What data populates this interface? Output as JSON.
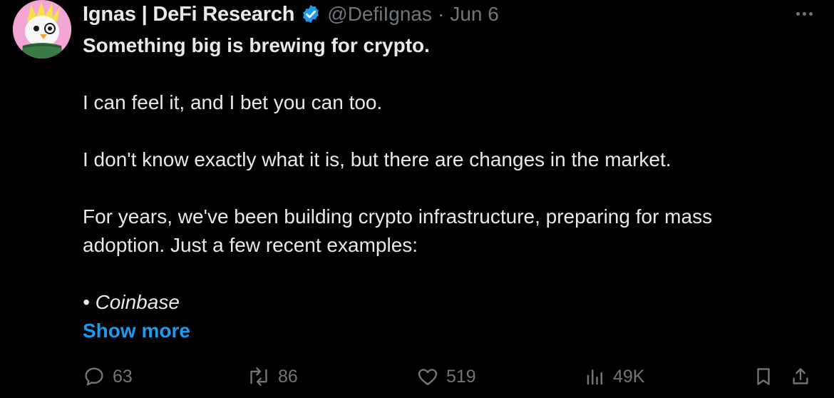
{
  "post": {
    "author_name": "Ignas | DeFi Research",
    "handle": "@DefiIgnas",
    "separator": "·",
    "date": "Jun 6",
    "body": {
      "lead": "Something big is brewing for crypto.",
      "p1": "I can feel it, and I bet you can too.",
      "p2": "I don't know exactly what it is, but there are changes in the market.",
      "p3_line1": "For years, we've been building crypto infrastructure, preparing for mass",
      "p3_line2": "adoption. Just a few recent examples:",
      "bullet": "• Coinbase"
    },
    "show_more": "Show more"
  },
  "actions": {
    "replies": "63",
    "reposts": "86",
    "likes": "519",
    "views": "49K"
  },
  "icons": {
    "verified": "verified-badge-icon",
    "more": "more-horizontal-icon",
    "reply": "reply-icon",
    "repost": "repost-icon",
    "like": "like-icon",
    "views": "views-icon",
    "bookmark": "bookmark-icon",
    "share": "share-icon"
  },
  "colors": {
    "background": "#000000",
    "text": "#e7e9ea",
    "secondary": "#71767b",
    "link": "#1d9bf0",
    "verified": "#1d9bf0"
  }
}
